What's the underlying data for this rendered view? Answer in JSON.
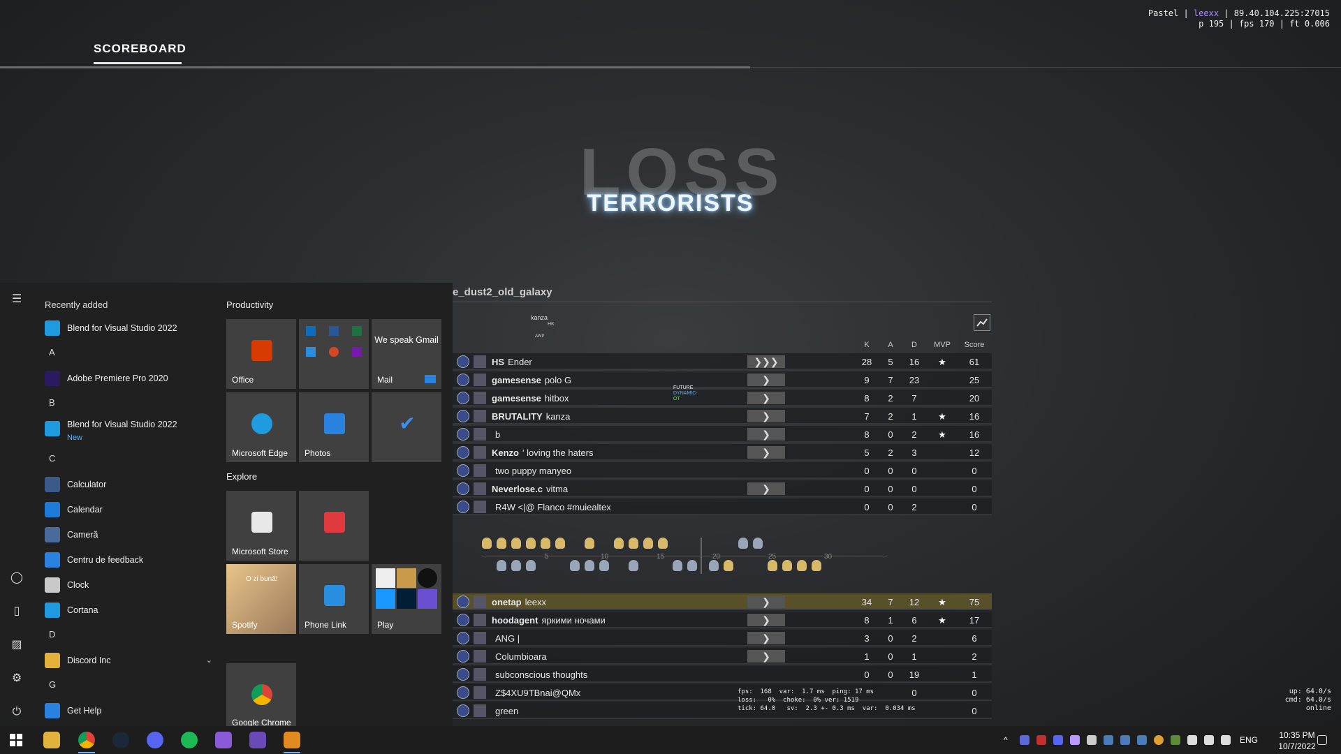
{
  "netinfo": {
    "line1_a": "Pastel | ",
    "line1_user": "leexx",
    "line1_b": " | 89.40.104.225:27015",
    "line2": "p 195 | fps 170 | ft 0.006"
  },
  "scoreboard": {
    "tab_label": "SCOREBOARD",
    "result": "LOSS",
    "team": "TERRORISTS",
    "map": "e_dust2_old_galaxy",
    "tag_top": "kanza",
    "tag_hk": "HK",
    "tag_awp": "AWP",
    "future_tag": "FUTURE",
    "future_tag2": "DYNAMIC-",
    "future_tag3": "OT"
  },
  "headers": {
    "k": "K",
    "a": "A",
    "d": "D",
    "mvp": "MVP",
    "score": "Score"
  },
  "team1": [
    {
      "clan": "HS",
      "name": "Ender",
      "k": "28",
      "a": "5",
      "d": "16",
      "mvp": "★",
      "score": "61",
      "vote": "❯❯❯"
    },
    {
      "clan": "gamesense",
      "name": "polo G",
      "k": "9",
      "a": "7",
      "d": "23",
      "mvp": "",
      "score": "25",
      "vote": "❯"
    },
    {
      "clan": "gamesense",
      "name": "hitbox",
      "k": "8",
      "a": "2",
      "d": "7",
      "mvp": "",
      "score": "20",
      "vote": "❯"
    },
    {
      "clan": "BRUTALITY",
      "name": "kanza",
      "k": "7",
      "a": "2",
      "d": "1",
      "mvp": "★",
      "score": "16",
      "vote": "❯"
    },
    {
      "clan": "",
      "name": "b",
      "k": "8",
      "a": "0",
      "d": "2",
      "mvp": "★",
      "score": "16",
      "vote": "❯"
    },
    {
      "clan": "Kenzo",
      "name": "' loving the haters",
      "k": "5",
      "a": "2",
      "d": "3",
      "mvp": "",
      "score": "12",
      "vote": "❯"
    },
    {
      "clan": "",
      "name": "two puppy manyeo",
      "k": "0",
      "a": "0",
      "d": "0",
      "mvp": "",
      "score": "0",
      "vote": ""
    },
    {
      "clan": "Neverlose.c",
      "name": "vitma",
      "k": "0",
      "a": "0",
      "d": "0",
      "mvp": "",
      "score": "0",
      "vote": "❯"
    },
    {
      "clan": "",
      "name": "R4W <|@ Flanco #muiealtex",
      "k": "0",
      "a": "0",
      "d": "2",
      "mvp": "",
      "score": "0",
      "vote": ""
    }
  ],
  "team2": [
    {
      "clan": "onetap",
      "name": "leexx",
      "k": "34",
      "a": "7",
      "d": "12",
      "mvp": "★",
      "score": "75",
      "vote": "❯"
    },
    {
      "clan": "hoodagent",
      "name": "яркими ночами",
      "k": "8",
      "a": "1",
      "d": "6",
      "mvp": "★",
      "score": "17",
      "vote": "❯"
    },
    {
      "clan": "",
      "name": "ANG |",
      "k": "3",
      "a": "0",
      "d": "2",
      "mvp": "",
      "score": "6",
      "vote": "❯"
    },
    {
      "clan": "",
      "name": "Columbioara",
      "k": "1",
      "a": "0",
      "d": "1",
      "mvp": "",
      "score": "2",
      "vote": "❯"
    },
    {
      "clan": "",
      "name": "subconscious thoughts",
      "k": "0",
      "a": "0",
      "d": "19",
      "mvp": "",
      "score": "1",
      "vote": ""
    },
    {
      "clan": "",
      "name": "Z$4XU9TBnai@QMx",
      "k": "",
      "a": "",
      "d": "0",
      "mvp": "",
      "score": "0",
      "vote": ""
    },
    {
      "clan": "",
      "name": "green",
      "k": "",
      "a": "",
      "d": "",
      "mvp": "",
      "score": "0",
      "vote": ""
    }
  ],
  "round_ticks": [
    "5",
    "10",
    "15",
    "20",
    "25",
    "30"
  ],
  "netgraph": "fps:  168  var:  1.7 ms  ping: 17 ms\nloss:   0%  choke:  0% ver: 1519\ntick: 64.0   sv:  2.3 +- 0.3 ms  var:  0.034 ms",
  "netinfo2": "up: 64.0/s\ncmd: 64.0/s\nonline",
  "startmenu": {
    "recently_added": "Recently added",
    "apps": [
      {
        "label": "Blend for Visual Studio 2022",
        "icon": "blend-icon",
        "color": "#1e9be0"
      },
      {
        "section": "A"
      },
      {
        "label": "Adobe Premiere Pro 2020",
        "icon": "premiere-icon",
        "color": "#2a1a5e"
      },
      {
        "section": "B"
      },
      {
        "label": "Blend for Visual Studio 2022",
        "sub": "New",
        "icon": "blend-icon",
        "color": "#1e9be0"
      },
      {
        "section": "C"
      },
      {
        "label": "Calculator",
        "icon": "calculator-icon",
        "color": "#3a5a8a"
      },
      {
        "label": "Calendar",
        "icon": "calendar-icon",
        "color": "#1e7ad8"
      },
      {
        "label": "Cameră",
        "icon": "camera-icon",
        "color": "#4a6a9a"
      },
      {
        "label": "Centru de feedback",
        "icon": "feedback-icon",
        "color": "#2a82e0"
      },
      {
        "label": "Clock",
        "icon": "clock-icon",
        "color": "#c9c9c9"
      },
      {
        "label": "Cortana",
        "icon": "cortana-icon",
        "color": "#1e9be0"
      },
      {
        "section": "D"
      },
      {
        "label": "Discord Inc",
        "icon": "folder-icon",
        "color": "#e3b23c",
        "expand": "⌄"
      },
      {
        "section": "G"
      },
      {
        "label": "Get Help",
        "icon": "help-icon",
        "color": "#2a82e0"
      }
    ],
    "productivity": "Productivity",
    "explore": "Explore",
    "tiles": {
      "office": "Office",
      "mail": "Mail",
      "gmail": "We speak Gmail",
      "edge": "Microsoft Edge",
      "photos": "Photos",
      "store": "Microsoft Store",
      "spotify": "Spotify",
      "spotify_text": "O zi bună!",
      "phone": "Phone Link",
      "play": "Play",
      "chrome": "Google Chrome"
    }
  },
  "taskbar": {
    "lang": "ENG",
    "time": "10:35 PM",
    "date": "10/7/2022"
  }
}
